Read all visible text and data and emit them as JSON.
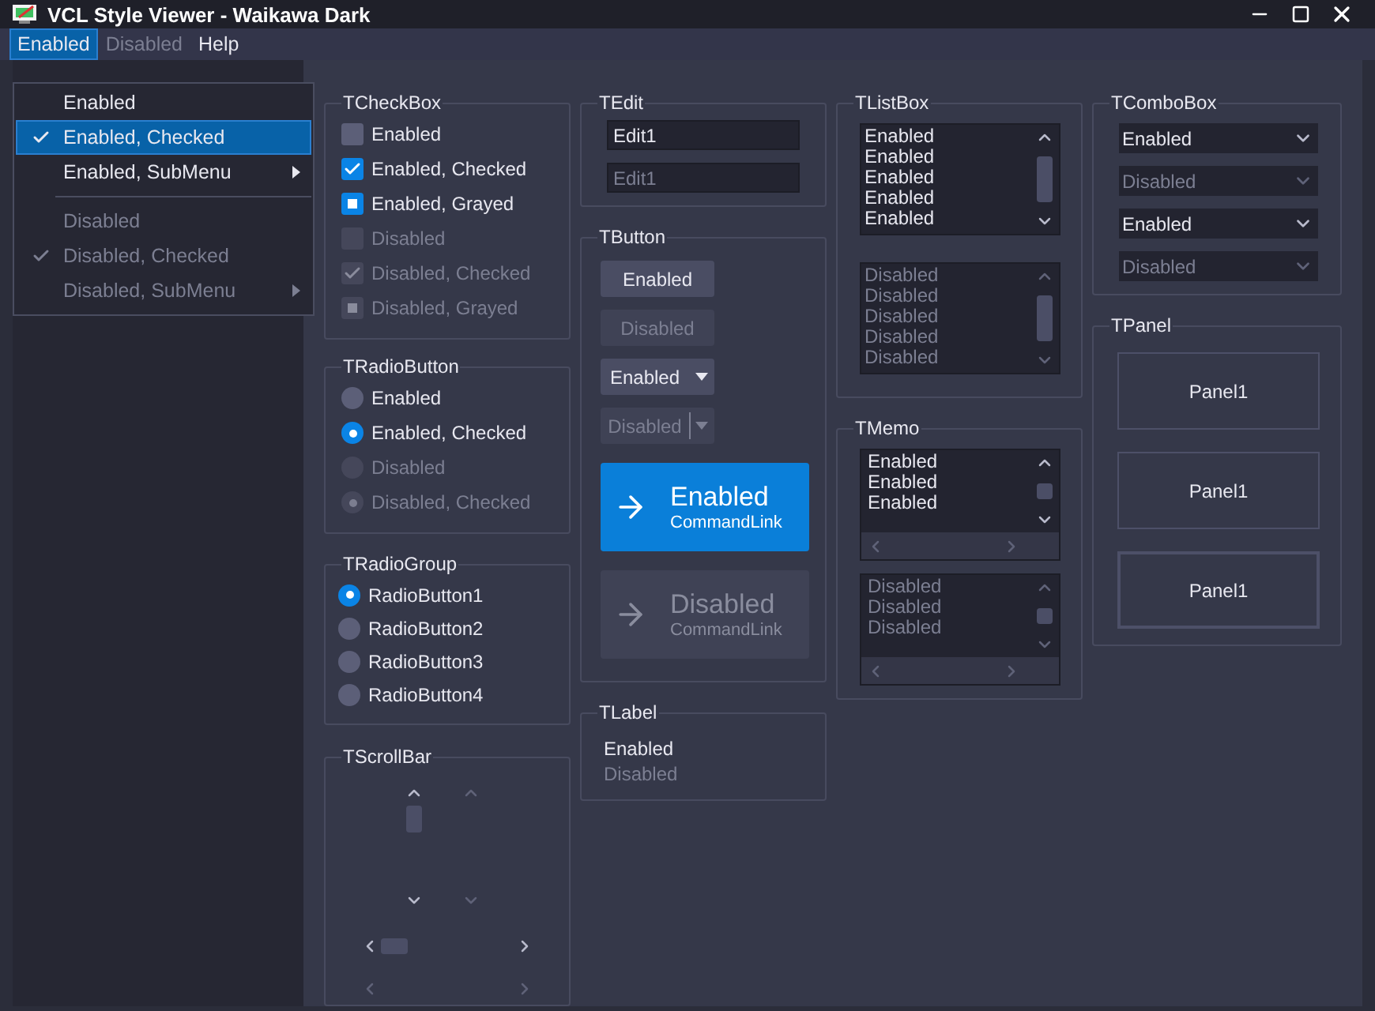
{
  "window": {
    "title": "VCL Style Viewer - Waikawa Dark"
  },
  "menubar": [
    {
      "label": "Enabled",
      "disabled": false,
      "selected": true
    },
    {
      "label": "Disabled",
      "disabled": true,
      "selected": false
    },
    {
      "label": "Help",
      "disabled": false,
      "selected": false
    }
  ],
  "menu": [
    {
      "kind": "item",
      "label": "Enabled",
      "checked": false,
      "disabled": false,
      "submenu": false,
      "selected": false
    },
    {
      "kind": "item",
      "label": "Enabled, Checked",
      "checked": true,
      "disabled": false,
      "submenu": false,
      "selected": true
    },
    {
      "kind": "item",
      "label": "Enabled, SubMenu",
      "checked": false,
      "disabled": false,
      "submenu": true,
      "selected": false
    },
    {
      "kind": "separator"
    },
    {
      "kind": "item",
      "label": "Disabled",
      "checked": false,
      "disabled": true,
      "submenu": false,
      "selected": false
    },
    {
      "kind": "item",
      "label": "Disabled, Checked",
      "checked": true,
      "disabled": true,
      "submenu": false,
      "selected": false
    },
    {
      "kind": "item",
      "label": "Disabled, SubMenu",
      "checked": false,
      "disabled": true,
      "submenu": true,
      "selected": false
    }
  ],
  "checkbox_group": {
    "title": "TCheckBox",
    "items": [
      {
        "label": "Enabled",
        "checked": false,
        "grayed": false,
        "disabled": false
      },
      {
        "label": "Enabled, Checked",
        "checked": true,
        "grayed": false,
        "disabled": false
      },
      {
        "label": "Enabled, Grayed",
        "checked": false,
        "grayed": true,
        "disabled": false
      },
      {
        "label": "Disabled",
        "checked": false,
        "grayed": false,
        "disabled": true
      },
      {
        "label": "Disabled, Checked",
        "checked": true,
        "grayed": false,
        "disabled": true
      },
      {
        "label": "Disabled, Grayed",
        "checked": false,
        "grayed": true,
        "disabled": true
      }
    ]
  },
  "radio_buttons": {
    "title": "TRadioButton",
    "items": [
      {
        "label": "Enabled",
        "checked": false,
        "disabled": false
      },
      {
        "label": "Enabled, Checked",
        "checked": true,
        "disabled": false
      },
      {
        "label": "Disabled",
        "checked": false,
        "disabled": true
      },
      {
        "label": "Disabled, Checked",
        "checked": true,
        "disabled": true
      }
    ]
  },
  "radio_group": {
    "title": "TRadioGroup",
    "items": [
      {
        "label": "RadioButton1",
        "selected": true
      },
      {
        "label": "RadioButton2",
        "selected": false
      },
      {
        "label": "RadioButton3",
        "selected": false
      },
      {
        "label": "RadioButton4",
        "selected": false
      }
    ]
  },
  "scrollbars": {
    "title": "TScrollBar",
    "bars": [
      {
        "kind": "vertical",
        "disabled": false
      },
      {
        "kind": "vertical",
        "disabled": true
      },
      {
        "kind": "horizontal",
        "disabled": false
      },
      {
        "kind": "horizontal",
        "disabled": true
      }
    ]
  },
  "edit": {
    "title": "TEdit",
    "fields": [
      {
        "value": "Edit1",
        "disabled": false
      },
      {
        "value": "Edit1",
        "disabled": true
      }
    ]
  },
  "buttons": {
    "title": "TButton",
    "items": [
      {
        "kind": "push",
        "label": "Enabled",
        "disabled": false
      },
      {
        "kind": "push",
        "label": "Disabled",
        "disabled": true
      },
      {
        "kind": "split",
        "label": "Enabled",
        "disabled": false
      },
      {
        "kind": "split",
        "label": "Disabled",
        "disabled": true
      },
      {
        "kind": "command_link",
        "label": "Enabled",
        "note": "CommandLink",
        "disabled": false
      },
      {
        "kind": "command_link",
        "label": "Disabled",
        "note": "CommandLink",
        "disabled": true
      }
    ]
  },
  "labels": {
    "title": "TLabel",
    "items": [
      {
        "text": "Enabled",
        "disabled": false
      },
      {
        "text": "Disabled",
        "disabled": true
      }
    ]
  },
  "listbox": {
    "title": "TListBox",
    "lists": [
      {
        "disabled": false,
        "items": [
          "Enabled",
          "Enabled",
          "Enabled",
          "Enabled",
          "Enabled"
        ]
      },
      {
        "disabled": true,
        "items": [
          "Disabled",
          "Disabled",
          "Disabled",
          "Disabled",
          "Disabled"
        ]
      }
    ]
  },
  "memo": {
    "title": "TMemo",
    "memos": [
      {
        "disabled": false,
        "lines": [
          "Enabled",
          "Enabled",
          "Enabled"
        ]
      },
      {
        "disabled": true,
        "lines": [
          "Disabled",
          "Disabled",
          "Disabled"
        ]
      }
    ]
  },
  "combobox": {
    "title": "TComboBox",
    "items": [
      {
        "value": "Enabled",
        "disabled": false
      },
      {
        "value": "Disabled",
        "disabled": true
      },
      {
        "value": "Enabled",
        "disabled": false
      },
      {
        "value": "Disabled",
        "disabled": true
      }
    ]
  },
  "panel": {
    "title": "TPanel",
    "panels": [
      {
        "label": "Panel1",
        "double_border": false
      },
      {
        "label": "Panel1",
        "double_border": false
      },
      {
        "label": "Panel1",
        "double_border": true
      }
    ]
  }
}
